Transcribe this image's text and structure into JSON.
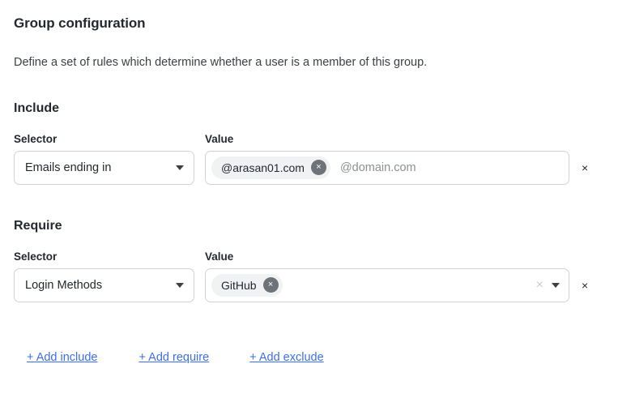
{
  "header": {
    "title": "Group configuration",
    "description": "Define a set of rules which determine whether a user is a member of this group."
  },
  "labels": {
    "selector": "Selector",
    "value": "Value",
    "remove_rule_icon": "×"
  },
  "sections": [
    {
      "heading": "Include",
      "selector": {
        "value": "Emails ending in",
        "caret_icon": "chevron-down-icon"
      },
      "value_field": {
        "chips": [
          {
            "label": "@arasan01.com",
            "remove_icon": "×"
          }
        ],
        "input_value": "",
        "placeholder": "@domain.com",
        "has_clear": false,
        "has_dropdown": false
      }
    },
    {
      "heading": "Require",
      "selector": {
        "value": "Login Methods",
        "caret_icon": "chevron-down-icon"
      },
      "value_field": {
        "chips": [
          {
            "label": "GitHub",
            "remove_icon": "×"
          }
        ],
        "input_value": "",
        "placeholder": "",
        "has_clear": true,
        "clear_icon": "×",
        "has_dropdown": true,
        "dropdown_icon": "chevron-down-icon"
      }
    }
  ],
  "actions": [
    {
      "label": "+ Add include"
    },
    {
      "label": "+ Add require"
    },
    {
      "label": "+ Add exclude"
    }
  ],
  "colors": {
    "link": "#3b6ef2",
    "chip_background": "#f1f2f3",
    "chip_remove_background": "#6e7279",
    "border": "#cfd3d8",
    "text": "#24292f",
    "placeholder": "#8b9096"
  }
}
